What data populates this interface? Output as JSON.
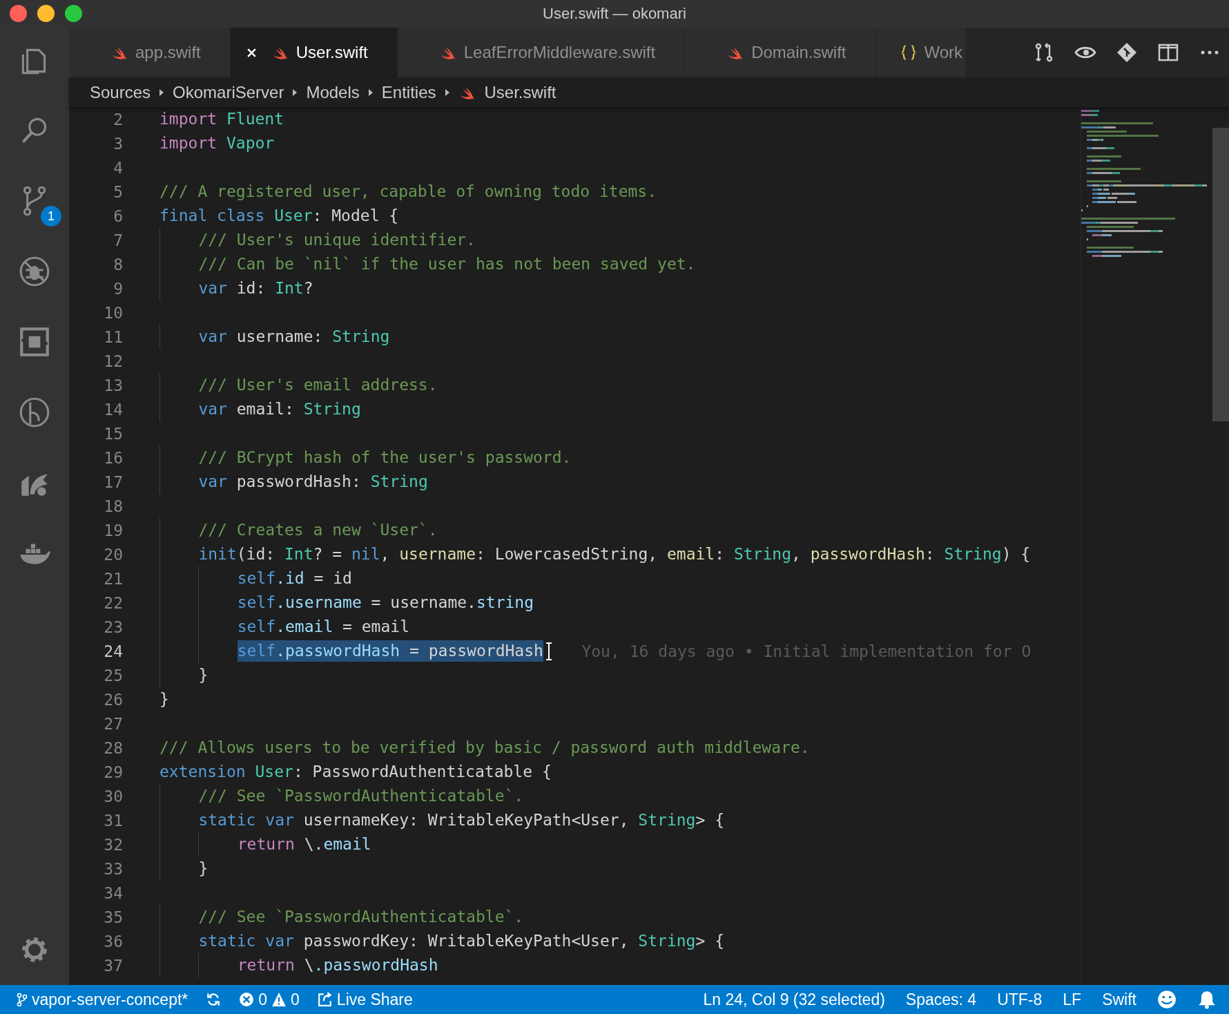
{
  "window": {
    "title": "User.swift — okomari"
  },
  "activity_bar": {
    "badge": "1"
  },
  "tabs": [
    {
      "label": "app.swift",
      "kind": "swift",
      "selected": false
    },
    {
      "label": "User.swift",
      "kind": "swift",
      "selected": true
    },
    {
      "label": "LeafErrorMiddleware.swift",
      "kind": "swift",
      "selected": false
    },
    {
      "label": "Domain.swift",
      "kind": "swift",
      "selected": false
    },
    {
      "label": "Work",
      "kind": "braces",
      "selected": false
    }
  ],
  "breadcrumb": [
    "Sources",
    "OkomariServer",
    "Models",
    "Entities",
    "User.swift"
  ],
  "editor": {
    "lines": [
      {
        "n": "2",
        "selected": false,
        "tokens": [
          {
            "text": "import ",
            "kind": "kw"
          },
          {
            "text": "Fluent",
            "kind": "type"
          }
        ]
      },
      {
        "n": "3",
        "selected": false,
        "tokens": [
          {
            "text": "import ",
            "kind": "kw"
          },
          {
            "text": "Vapor",
            "kind": "type"
          }
        ]
      },
      {
        "n": "4",
        "selected": false
      },
      {
        "n": "5",
        "selected": false,
        "tokens": [
          {
            "text": "/// A registered user, capable of owning todo items.",
            "kind": "cm"
          }
        ]
      },
      {
        "n": "6",
        "selected": false,
        "tokens": [
          {
            "text": "final class ",
            "kind": "decl"
          },
          {
            "text": "User",
            "kind": "type"
          },
          {
            "text": ": Model {",
            "kind": "plain"
          }
        ]
      },
      {
        "n": "7",
        "selected": false,
        "tokens": [
          {
            "text": "    /// User's unique identifier.",
            "kind": "cm"
          }
        ]
      },
      {
        "n": "8",
        "selected": false,
        "tokens": [
          {
            "text": "    /// Can be `nil` if the user has not been saved yet.",
            "kind": "cm"
          }
        ]
      },
      {
        "n": "9",
        "selected": false,
        "tokens": [
          {
            "text": "    var ",
            "kind": "decl"
          },
          {
            "text": "id: ",
            "kind": "plain"
          },
          {
            "text": "Int",
            "kind": "type"
          },
          {
            "text": "?",
            "kind": "plain"
          }
        ]
      },
      {
        "n": "10",
        "selected": false
      },
      {
        "n": "11",
        "selected": false,
        "tokens": [
          {
            "text": "    var ",
            "kind": "decl"
          },
          {
            "text": "username: ",
            "kind": "plain"
          },
          {
            "text": "String",
            "kind": "type"
          }
        ]
      },
      {
        "n": "12",
        "selected": false
      },
      {
        "n": "13",
        "selected": false,
        "tokens": [
          {
            "text": "    /// User's email address.",
            "kind": "cm"
          }
        ]
      },
      {
        "n": "14",
        "selected": false,
        "tokens": [
          {
            "text": "    var ",
            "kind": "decl"
          },
          {
            "text": "email: ",
            "kind": "plain"
          },
          {
            "text": "String",
            "kind": "type"
          }
        ]
      },
      {
        "n": "15",
        "selected": false
      },
      {
        "n": "16",
        "selected": false,
        "tokens": [
          {
            "text": "    /// BCrypt hash of the user's password.",
            "kind": "cm"
          }
        ]
      },
      {
        "n": "17",
        "selected": false,
        "tokens": [
          {
            "text": "    var ",
            "kind": "decl"
          },
          {
            "text": "passwordHash: ",
            "kind": "plain"
          },
          {
            "text": "String",
            "kind": "type"
          }
        ]
      },
      {
        "n": "18",
        "selected": false
      },
      {
        "n": "19",
        "selected": false,
        "tokens": [
          {
            "text": "    /// Creates a new `User`.",
            "kind": "cm"
          }
        ]
      },
      {
        "n": "20",
        "selected": false,
        "tokens": [
          {
            "text": "    init",
            "kind": "decl"
          },
          {
            "text": "(id: ",
            "kind": "plain"
          },
          {
            "text": "Int",
            "kind": "type"
          },
          {
            "text": "? = ",
            "kind": "plain"
          },
          {
            "text": "nil",
            "kind": "decl"
          },
          {
            "text": ", ",
            "kind": "plain"
          },
          {
            "text": "username",
            "kind": "param"
          },
          {
            "text": ": LowercasedString, ",
            "kind": "plain"
          },
          {
            "text": "email",
            "kind": "param"
          },
          {
            "text": ": ",
            "kind": "plain"
          },
          {
            "text": "String",
            "kind": "type"
          },
          {
            "text": ", ",
            "kind": "plain"
          },
          {
            "text": "passwordHash",
            "kind": "param"
          },
          {
            "text": ": ",
            "kind": "plain"
          },
          {
            "text": "String",
            "kind": "type"
          },
          {
            "text": ") {",
            "kind": "plain"
          }
        ]
      },
      {
        "n": "21",
        "selected": false,
        "tokens": [
          {
            "text": "        self",
            "kind": "decl"
          },
          {
            "text": ".id",
            "kind": "prop"
          },
          {
            "text": " = id",
            "kind": "plain"
          }
        ]
      },
      {
        "n": "22",
        "selected": false,
        "tokens": [
          {
            "text": "        self",
            "kind": "decl"
          },
          {
            "text": ".username",
            "kind": "prop"
          },
          {
            "text": " = username.",
            "kind": "plain"
          },
          {
            "text": "string",
            "kind": "prop"
          }
        ]
      },
      {
        "n": "23",
        "selected": false,
        "tokens": [
          {
            "text": "        self",
            "kind": "decl"
          },
          {
            "text": ".email",
            "kind": "prop"
          },
          {
            "text": " = email",
            "kind": "plain"
          }
        ]
      },
      {
        "n": "24",
        "selected": true,
        "tokens": [
          {
            "text": "        self",
            "kind": "decl"
          },
          {
            "text": ".passwordHash",
            "kind": "prop"
          },
          {
            "text": " = passwordHash",
            "kind": "plain"
          }
        ],
        "blame": "You, 16 days ago • Initial implementation for O"
      },
      {
        "n": "25",
        "selected": false,
        "tokens": [
          {
            "text": "    }",
            "kind": "plain"
          }
        ]
      },
      {
        "n": "26",
        "selected": false,
        "tokens": [
          {
            "text": "}",
            "kind": "plain"
          }
        ]
      },
      {
        "n": "27",
        "selected": false
      },
      {
        "n": "28",
        "selected": false,
        "tokens": [
          {
            "text": "/// Allows users to be verified by basic / password auth middleware.",
            "kind": "cm"
          }
        ]
      },
      {
        "n": "29",
        "selected": false,
        "tokens": [
          {
            "text": "extension ",
            "kind": "decl"
          },
          {
            "text": "User",
            "kind": "type"
          },
          {
            "text": ": PasswordAuthenticatable {",
            "kind": "plain"
          }
        ]
      },
      {
        "n": "30",
        "selected": false,
        "tokens": [
          {
            "text": "    /// See `PasswordAuthenticatable`.",
            "kind": "cm"
          }
        ]
      },
      {
        "n": "31",
        "selected": false,
        "tokens": [
          {
            "text": "    static var ",
            "kind": "decl"
          },
          {
            "text": "usernameKey: WritableKeyPath<User, ",
            "kind": "plain"
          },
          {
            "text": "String",
            "kind": "type"
          },
          {
            "text": "> {",
            "kind": "plain"
          }
        ]
      },
      {
        "n": "32",
        "selected": false,
        "tokens": [
          {
            "text": "        return ",
            "kind": "kw"
          },
          {
            "text": "\\",
            "kind": "plain"
          },
          {
            "text": ".email",
            "kind": "prop"
          }
        ]
      },
      {
        "n": "33",
        "selected": false,
        "tokens": [
          {
            "text": "    }",
            "kind": "plain"
          }
        ]
      },
      {
        "n": "34",
        "selected": false
      },
      {
        "n": "35",
        "selected": false,
        "tokens": [
          {
            "text": "    /// See `PasswordAuthenticatable`.",
            "kind": "cm"
          }
        ]
      },
      {
        "n": "36",
        "selected": false,
        "tokens": [
          {
            "text": "    static var ",
            "kind": "decl"
          },
          {
            "text": "passwordKey: WritableKeyPath<User, ",
            "kind": "plain"
          },
          {
            "text": "String",
            "kind": "type"
          },
          {
            "text": "> {",
            "kind": "plain"
          }
        ]
      },
      {
        "n": "37",
        "selected": false,
        "tokens": [
          {
            "text": "        return ",
            "kind": "kw"
          },
          {
            "text": "\\",
            "kind": "plain"
          },
          {
            "text": ".passwordHash",
            "kind": "prop"
          }
        ]
      }
    ]
  },
  "status_bar": {
    "branch": "vapor-server-concept*",
    "errors": "0",
    "warnings": "0",
    "live_share": "Live Share",
    "position": "Ln 24, Col 9 (32 selected)",
    "spaces": "Spaces: 4",
    "encoding": "UTF-8",
    "eol": "LF",
    "language": "Swift"
  }
}
